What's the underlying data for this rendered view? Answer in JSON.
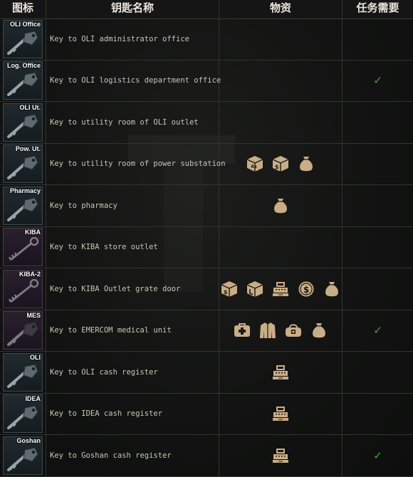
{
  "header": {
    "col_icon": "图标",
    "col_name": "钥匙名称",
    "col_items": "物资",
    "col_quest": "任务需要"
  },
  "colors": {
    "check": "#3fae2a",
    "item_icon": "#c9ad86",
    "key_tile_default": "#1f2a2f",
    "key_tile_purple": "#2b1f2e"
  },
  "rows": [
    {
      "tag": "OLI Office",
      "name": "Key to OLI administrator office",
      "items": [],
      "quest": ""
    },
    {
      "tag": "Log. Office",
      "name": "Key to OLI logistics department office",
      "items": [],
      "quest": "✓"
    },
    {
      "tag": "OLI Ut.",
      "name": "Key to utility room of OLI outlet",
      "items": [],
      "quest": ""
    },
    {
      "tag": "Pow. Ut.",
      "name": "Key to utility room of power substation",
      "items": [
        "crate-rx-icon",
        "crate-dollar-icon",
        "bag-icon"
      ],
      "quest": ""
    },
    {
      "tag": "Pharmacy",
      "name": "Key to pharmacy",
      "items": [
        "bag-icon"
      ],
      "quest": ""
    },
    {
      "tag": "KIBA",
      "name": "Key to KIBA store outlet",
      "items": [],
      "quest": ""
    },
    {
      "tag": "KIBA-2",
      "name": "Key to KIBA Outlet grate door",
      "items": [
        "crate-dollar-icon",
        "crate-l-icon",
        "cash-register-icon",
        "coin-icon",
        "bag-icon"
      ],
      "quest": ""
    },
    {
      "tag": "MES",
      "name": "Key to EMERCOM medical unit",
      "items": [
        "medkit-icon",
        "jacket-icon",
        "toolbag-icon",
        "bag-icon"
      ],
      "quest": "✓"
    },
    {
      "tag": "OLI",
      "name": "Key to OLI cash register",
      "items": [
        "cash-register-icon"
      ],
      "quest": ""
    },
    {
      "tag": "IDEA",
      "name": "Key to IDEA cash register",
      "items": [
        "cash-register-icon"
      ],
      "quest": ""
    },
    {
      "tag": "Goshan",
      "name": "Key to Goshan cash register",
      "items": [
        "cash-register-icon"
      ],
      "quest": "✓"
    }
  ]
}
